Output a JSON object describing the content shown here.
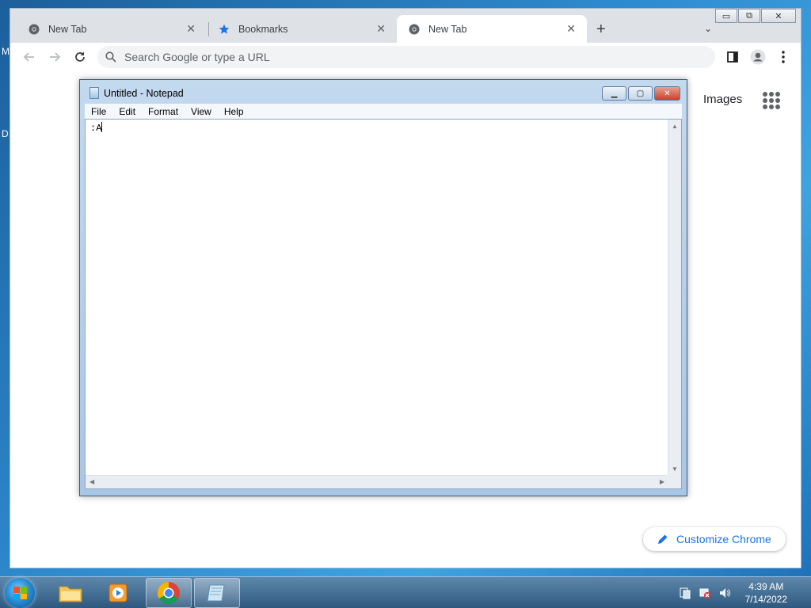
{
  "chrome": {
    "tabs": [
      {
        "label": "New Tab",
        "icon": "chrome-icon",
        "active": false
      },
      {
        "label": "Bookmarks",
        "icon": "star-icon",
        "active": false
      },
      {
        "label": "New Tab",
        "icon": "chrome-icon",
        "active": true
      }
    ],
    "tab_close_glyph": "✕",
    "new_tab_glyph": "+",
    "tab_search_glyph": "⌄",
    "window_controls": {
      "minimize": "▭",
      "restore": "⧉",
      "close": "✕"
    },
    "omnibox": {
      "placeholder": "Search Google or type a URL",
      "value": ""
    },
    "ntp": {
      "images_label": "Images",
      "customize_label": "Customize Chrome"
    },
    "accent_color": "#1a73e8"
  },
  "notepad": {
    "title": "Untitled - Notepad",
    "menus": [
      "File",
      "Edit",
      "Format",
      "View",
      "Help"
    ],
    "content": ":A",
    "controls": {
      "minimize": "▁",
      "maximize": "▢",
      "close": "✕"
    }
  },
  "desktop": {
    "sliver_letters": [
      "M",
      "D"
    ]
  },
  "taskbar": {
    "items": [
      {
        "name": "explorer",
        "icon": "folder-icon",
        "active": false
      },
      {
        "name": "media-player",
        "icon": "media-player-icon",
        "active": false
      },
      {
        "name": "chrome",
        "icon": "chrome-icon",
        "active": true
      },
      {
        "name": "notepad",
        "icon": "notepad-icon",
        "active": true
      }
    ],
    "clock": {
      "time": "4:39 AM",
      "date": "7/14/2022"
    }
  }
}
